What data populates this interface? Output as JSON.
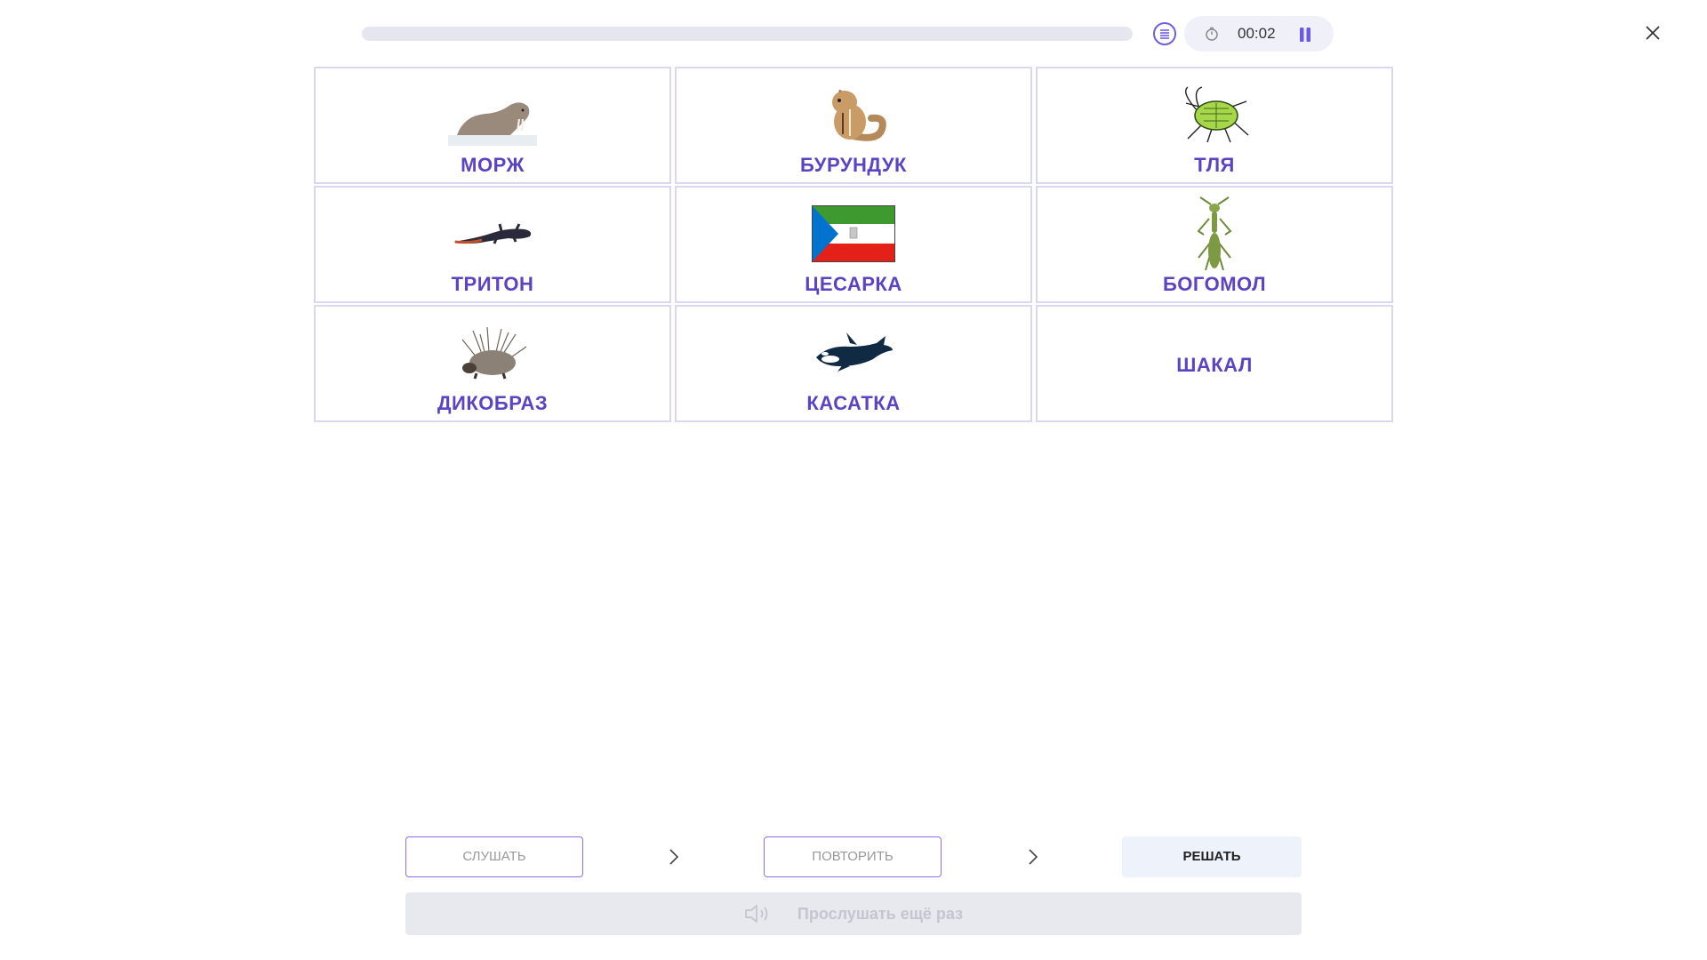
{
  "header": {
    "progress": 0,
    "timer": "00:02",
    "icons": {
      "list": "list-icon",
      "stopwatch": "stopwatch-icon",
      "pause": "pause-icon",
      "close": "close-icon"
    }
  },
  "cards": [
    {
      "label": "МОРЖ",
      "image": "walrus"
    },
    {
      "label": "БУРУНДУК",
      "image": "chipmunk"
    },
    {
      "label": "ТЛЯ",
      "image": "aphid"
    },
    {
      "label": "ТРИТОН",
      "image": "newt"
    },
    {
      "label": "ЦЕСАРКА",
      "image": "equatorial-guinea-flag"
    },
    {
      "label": "БОГОМОЛ",
      "image": "mantis"
    },
    {
      "label": "ДИКОБРАЗ",
      "image": "porcupine"
    },
    {
      "label": "КАСАТКА",
      "image": "orca"
    },
    {
      "label": "ШАКАЛ",
      "image": ""
    }
  ],
  "footer": {
    "listen": "СЛУШАТЬ",
    "repeat": "ПОВТОРИТЬ",
    "solve": "РЕШАТЬ",
    "replay": "Прослушать ещё раз"
  },
  "colors": {
    "accent": "#5a44c4",
    "card_border": "#d9d7f2",
    "button_border": "#8d6ef0"
  }
}
